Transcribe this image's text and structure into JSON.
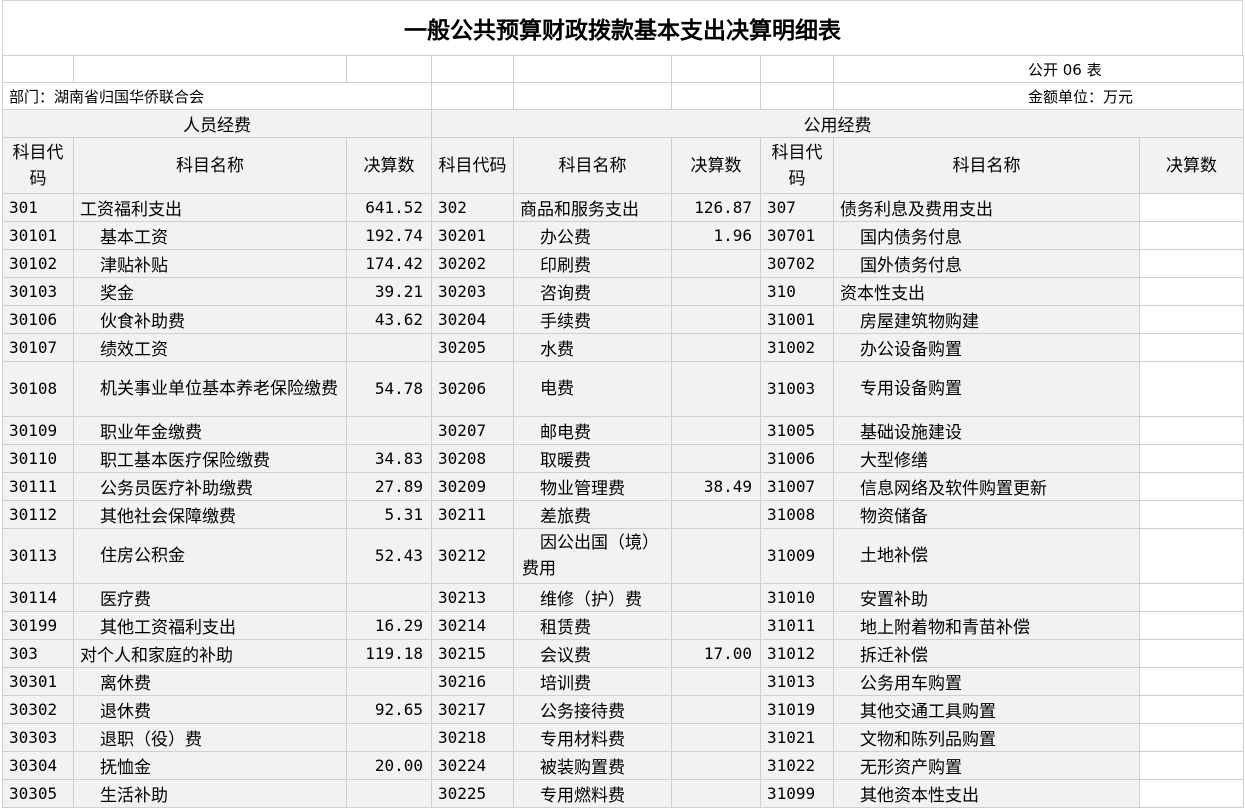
{
  "title": "一般公共预算财政拨款基本支出决算明细表",
  "table_no": "公开 06 表",
  "department": "部门：湖南省归国华侨联合会",
  "unit": "金额单位：万元",
  "groups": {
    "personnel": "人员经费",
    "public": "公用经费"
  },
  "headers": {
    "code": "科目代码",
    "code_b": "科目代码",
    "name": "科目名称",
    "amount": "决算数"
  },
  "rows": [
    {
      "c1": "301",
      "n1": "工资福利支出",
      "a1": "641.52",
      "c2": "302",
      "n2": "商品和服务支出",
      "a2": "126.87",
      "c3": "307",
      "n3": "债务利息及费用支出",
      "a3": ""
    },
    {
      "c1": "30101",
      "n1": "基本工资",
      "a1": "192.74",
      "c2": "30201",
      "n2": "办公费",
      "a2": "1.96",
      "c3": "30701",
      "n3": "国内债务付息",
      "a3": ""
    },
    {
      "c1": "30102",
      "n1": "津贴补贴",
      "a1": "174.42",
      "c2": "30202",
      "n2": "印刷费",
      "a2": "",
      "c3": "30702",
      "n3": "国外债务付息",
      "a3": ""
    },
    {
      "c1": "30103",
      "n1": "奖金",
      "a1": "39.21",
      "c2": "30203",
      "n2": "咨询费",
      "a2": "",
      "c3": "310",
      "n3": "资本性支出",
      "a3": ""
    },
    {
      "c1": "30106",
      "n1": "伙食补助费",
      "a1": "43.62",
      "c2": "30204",
      "n2": "手续费",
      "a2": "",
      "c3": "31001",
      "n3": "房屋建筑物购建",
      "a3": ""
    },
    {
      "c1": "30107",
      "n1": "绩效工资",
      "a1": "",
      "c2": "30205",
      "n2": "水费",
      "a2": "",
      "c3": "31002",
      "n3": "办公设备购置",
      "a3": ""
    },
    {
      "c1": "30108",
      "n1": "机关事业单位基本养老保险缴费",
      "a1": "54.78",
      "c2": "30206",
      "n2": "电费",
      "a2": "",
      "c3": "31003",
      "n3": "专用设备购置",
      "a3": ""
    },
    {
      "c1": "30109",
      "n1": "职业年金缴费",
      "a1": "",
      "c2": "30207",
      "n2": "邮电费",
      "a2": "",
      "c3": "31005",
      "n3": "基础设施建设",
      "a3": ""
    },
    {
      "c1": "30110",
      "n1": "职工基本医疗保险缴费",
      "a1": "34.83",
      "c2": "30208",
      "n2": "取暖费",
      "a2": "",
      "c3": "31006",
      "n3": "大型修缮",
      "a3": ""
    },
    {
      "c1": "30111",
      "n1": "公务员医疗补助缴费",
      "a1": "27.89",
      "c2": "30209",
      "n2": "物业管理费",
      "a2": "38.49",
      "c3": "31007",
      "n3": "信息网络及软件购置更新",
      "a3": ""
    },
    {
      "c1": "30112",
      "n1": "其他社会保障缴费",
      "a1": "5.31",
      "c2": "30211",
      "n2": "差旅费",
      "a2": "",
      "c3": "31008",
      "n3": "物资储备",
      "a3": ""
    },
    {
      "c1": "30113",
      "n1": "住房公积金",
      "a1": "52.43",
      "c2": "30212",
      "n2": "因公出国（境）费用",
      "a2": "",
      "c3": "31009",
      "n3": "土地补偿",
      "a3": ""
    },
    {
      "c1": "30114",
      "n1": "医疗费",
      "a1": "",
      "c2": "30213",
      "n2": "维修（护）费",
      "a2": "",
      "c3": "31010",
      "n3": "安置补助",
      "a3": ""
    },
    {
      "c1": "30199",
      "n1": "其他工资福利支出",
      "a1": "16.29",
      "c2": "30214",
      "n2": "租赁费",
      "a2": "",
      "c3": "31011",
      "n3": "地上附着物和青苗补偿",
      "a3": ""
    },
    {
      "c1": "303",
      "n1": "对个人和家庭的补助",
      "a1": "119.18",
      "c2": "30215",
      "n2": "会议费",
      "a2": "17.00",
      "c3": "31012",
      "n3": "拆迁补偿",
      "a3": ""
    },
    {
      "c1": "30301",
      "n1": "离休费",
      "a1": "",
      "c2": "30216",
      "n2": "培训费",
      "a2": "",
      "c3": "31013",
      "n3": "公务用车购置",
      "a3": ""
    },
    {
      "c1": "30302",
      "n1": "退休费",
      "a1": "92.65",
      "c2": "30217",
      "n2": "公务接待费",
      "a2": "",
      "c3": "31019",
      "n3": "其他交通工具购置",
      "a3": ""
    },
    {
      "c1": "30303",
      "n1": "退职（役）费",
      "a1": "",
      "c2": "30218",
      "n2": "专用材料费",
      "a2": "",
      "c3": "31021",
      "n3": "文物和陈列品购置",
      "a3": ""
    },
    {
      "c1": "30304",
      "n1": "抚恤金",
      "a1": "20.00",
      "c2": "30224",
      "n2": "被装购置费",
      "a2": "",
      "c3": "31022",
      "n3": "无形资产购置",
      "a3": ""
    },
    {
      "c1": "30305",
      "n1": "生活补助",
      "a1": "",
      "c2": "30225",
      "n2": "专用燃料费",
      "a2": "",
      "c3": "31099",
      "n3": "其他资本性支出",
      "a3": ""
    }
  ]
}
